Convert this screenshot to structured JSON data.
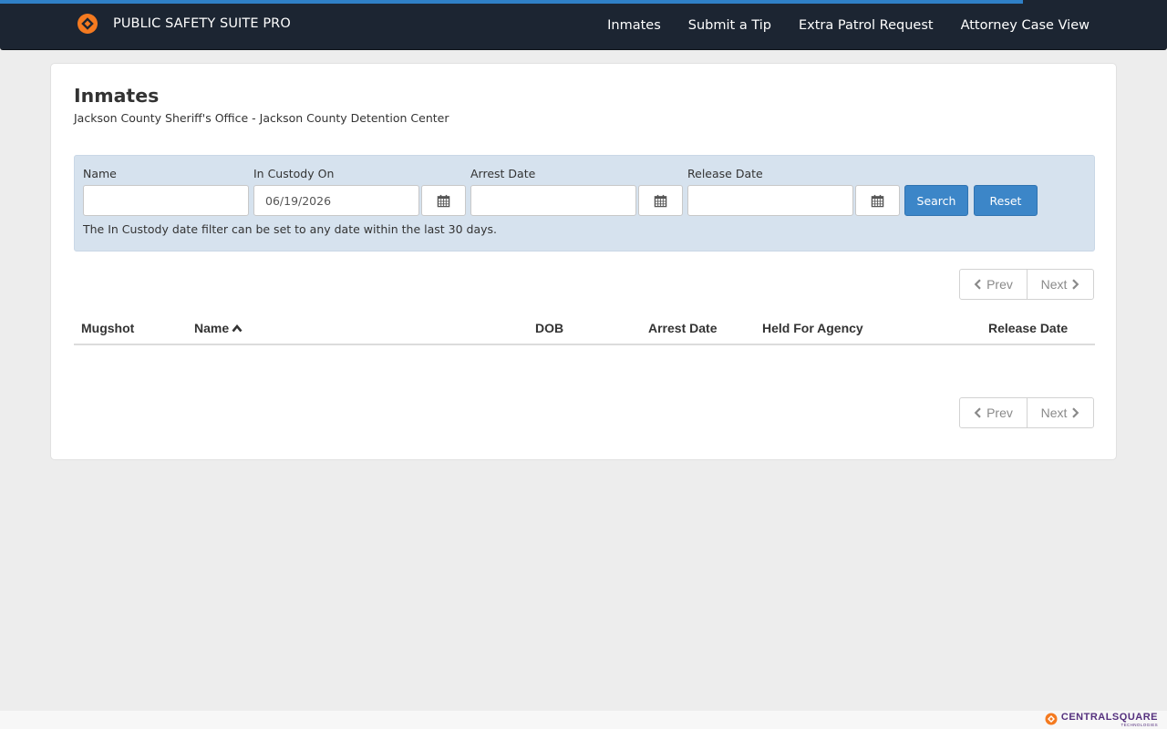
{
  "header": {
    "brand": "PUBLIC SAFETY SUITE PRO",
    "nav": [
      "Inmates",
      "Submit a Tip",
      "Extra Patrol Request",
      "Attorney Case View"
    ]
  },
  "page": {
    "title": "Inmates",
    "subtitle": "Jackson County Sheriff's Office - Jackson County Detention Center"
  },
  "filters": {
    "name_label": "Name",
    "name_value": "",
    "custody_label": "In Custody On",
    "custody_value": "06/19/2026",
    "arrest_label": "Arrest Date",
    "arrest_value": "",
    "release_label": "Release Date",
    "release_value": "",
    "search_label": "Search",
    "reset_label": "Reset",
    "note": "The In Custody date filter can be set to any date within the last 30 days."
  },
  "pagination": {
    "prev_label": "Prev",
    "next_label": "Next"
  },
  "table": {
    "columns": [
      "Mugshot",
      "Name",
      "DOB",
      "Arrest Date",
      "Held For Agency",
      "Release Date"
    ],
    "sorted_column": "Name",
    "sort_direction": "ascending",
    "rows": []
  },
  "footer": {
    "brand": "CENTRALSQUARE",
    "sub": "TECHNOLOGIES"
  },
  "colors": {
    "navbar": "#1c2532",
    "accent": "#3c86c8",
    "brand_orange": "#f47a20",
    "filter_panel": "#d6e2ee",
    "footer_purple": "#55307e"
  },
  "icons": {
    "brand": "diamond-logo-icon",
    "date_picker": "calendar-icon",
    "prev": "chevron-left-icon",
    "next": "chevron-right-icon",
    "sort": "chevron-up-icon"
  }
}
